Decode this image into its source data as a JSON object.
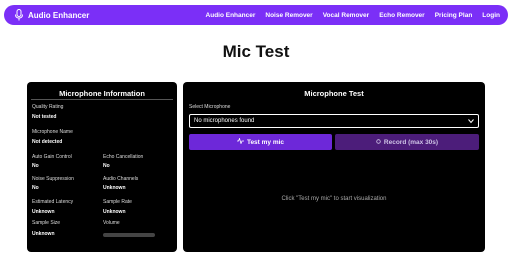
{
  "nav": {
    "brand": "Audio Enhancer",
    "links": [
      "Audio Enhancer",
      "Noise Remover",
      "Vocal Remover",
      "Echo Remover",
      "Pricing Plan",
      "Login"
    ]
  },
  "page_title": "Mic Test",
  "info_panel": {
    "title": "Microphone Information",
    "quality_rating": {
      "label": "Quality Rating",
      "value": "Not tested"
    },
    "mic_name": {
      "label": "Microphone Name",
      "value": "Not detected"
    },
    "auto_gain": {
      "label": "Auto Gain Control",
      "value": "No"
    },
    "echo_cancel": {
      "label": "Echo Cancellation",
      "value": "No"
    },
    "noise_supp": {
      "label": "Noise Suppression",
      "value": "No"
    },
    "audio_channels": {
      "label": "Audio Channels",
      "value": "Unknown"
    },
    "latency": {
      "label": "Estimated Latency",
      "value": "Unknown"
    },
    "sample_rate": {
      "label": "Sample Rate",
      "value": "Unknown"
    },
    "sample_size": {
      "label": "Sample Size",
      "value": "Unknown"
    },
    "volume": {
      "label": "Volume",
      "value": "0%",
      "level": 0
    }
  },
  "test_panel": {
    "title": "Microphone Test",
    "select_label": "Select Microphone",
    "select_value": "No microphones found",
    "test_button": "Test my mic",
    "record_button": "Record (max 30s)",
    "hint": "Click \"Test my mic\" to start visualization"
  },
  "colors": {
    "accent": "#7b2ff7",
    "panel": "#000000"
  }
}
